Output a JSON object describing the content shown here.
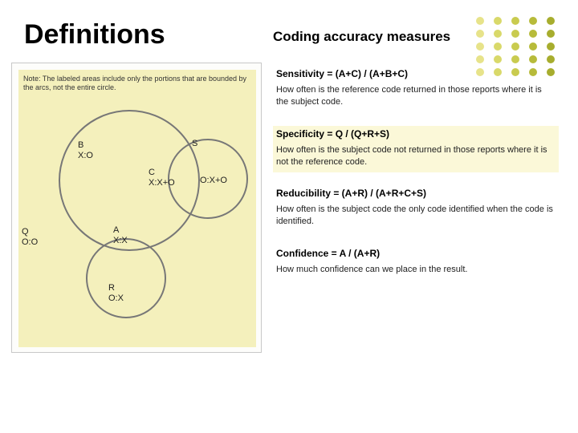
{
  "title": "Definitions",
  "subtitle": "Coding accuracy measures",
  "diagram": {
    "note": "Note: The labeled areas include only the portions that are bounded by the arcs, not the entire circle.",
    "regions": {
      "B": "B\nX:O",
      "C": "C\nX:X+O",
      "S": "S",
      "O": "O:X+O",
      "Q": "Q\nO:O",
      "A": "A\nX:X",
      "R": "R\nO:X"
    }
  },
  "measures": [
    {
      "name": "Sensitivity",
      "formula": "Sensitivity = (A+C) / (A+B+C)",
      "desc": "How often is the reference code returned in those reports where it is the subject code.",
      "highlight": false
    },
    {
      "name": "Specificity",
      "formula": "Specificity = Q / (Q+R+S)",
      "desc": "How often is the subject code not returned in those reports where it is not the reference code.",
      "highlight": true
    },
    {
      "name": "Reducibility",
      "formula": "Reducibility = (A+R) / (A+R+C+S)",
      "desc": "How often is the subject code the only code identified when the code is identified.",
      "highlight": false
    },
    {
      "name": "Confidence",
      "formula": "Confidence = A / (A+R)",
      "desc": "How much confidence can we place in the result.",
      "highlight": false
    }
  ],
  "dot_colors": {
    "col1": "#e7e38a",
    "col2": "#d9d96a",
    "col3": "#c9cb4f",
    "col4": "#b7bb3a",
    "col5": "#a7ad2e"
  }
}
